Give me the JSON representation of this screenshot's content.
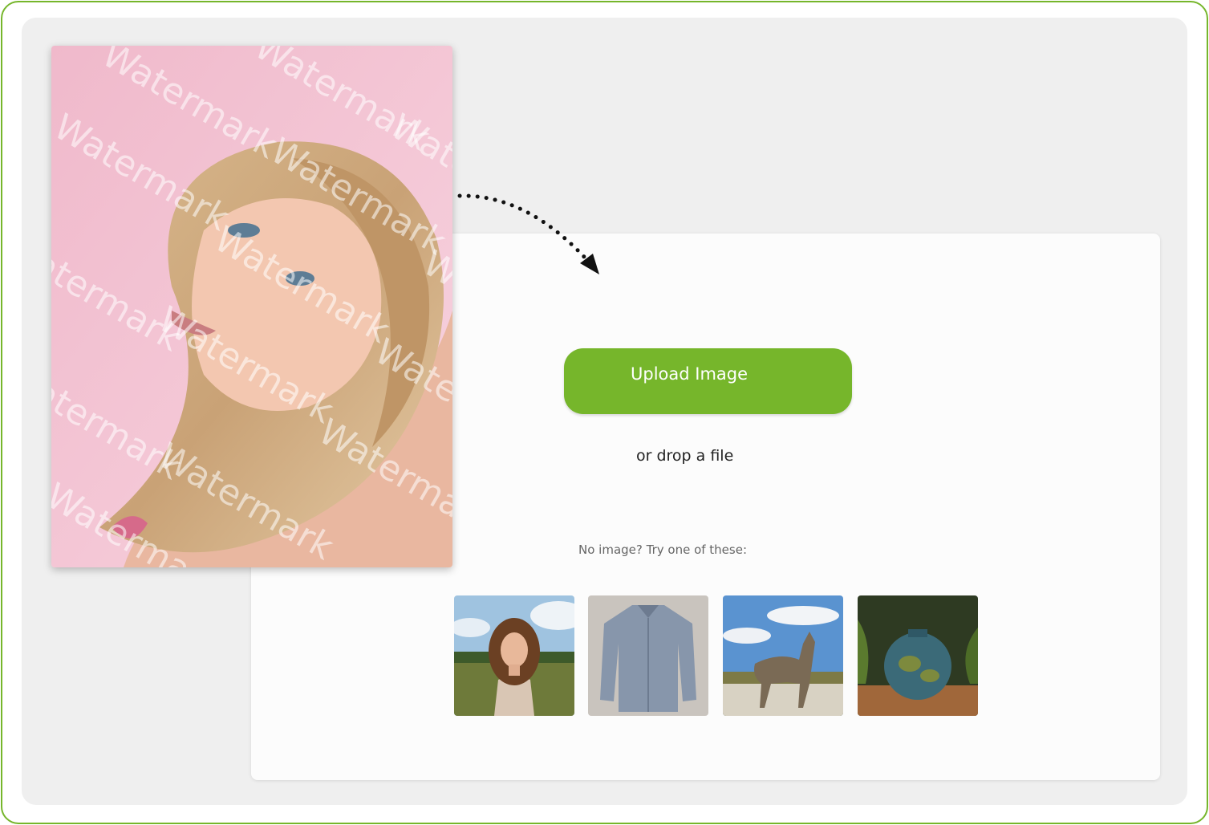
{
  "upload": {
    "button_label": "Upload Image",
    "drop_text": "or drop a file",
    "samples_hint": "No image? Try one of these:"
  },
  "preview": {
    "watermark_text": "Watermark"
  },
  "samples": [
    {
      "icon": "woman-portrait-thumbnail"
    },
    {
      "icon": "shirt-thumbnail"
    },
    {
      "icon": "wolf-thumbnail"
    },
    {
      "icon": "vase-thumbnail"
    }
  ],
  "colors": {
    "accent": "#76b62b",
    "canvas": "#efefef",
    "panel": "#fcfcfc"
  }
}
